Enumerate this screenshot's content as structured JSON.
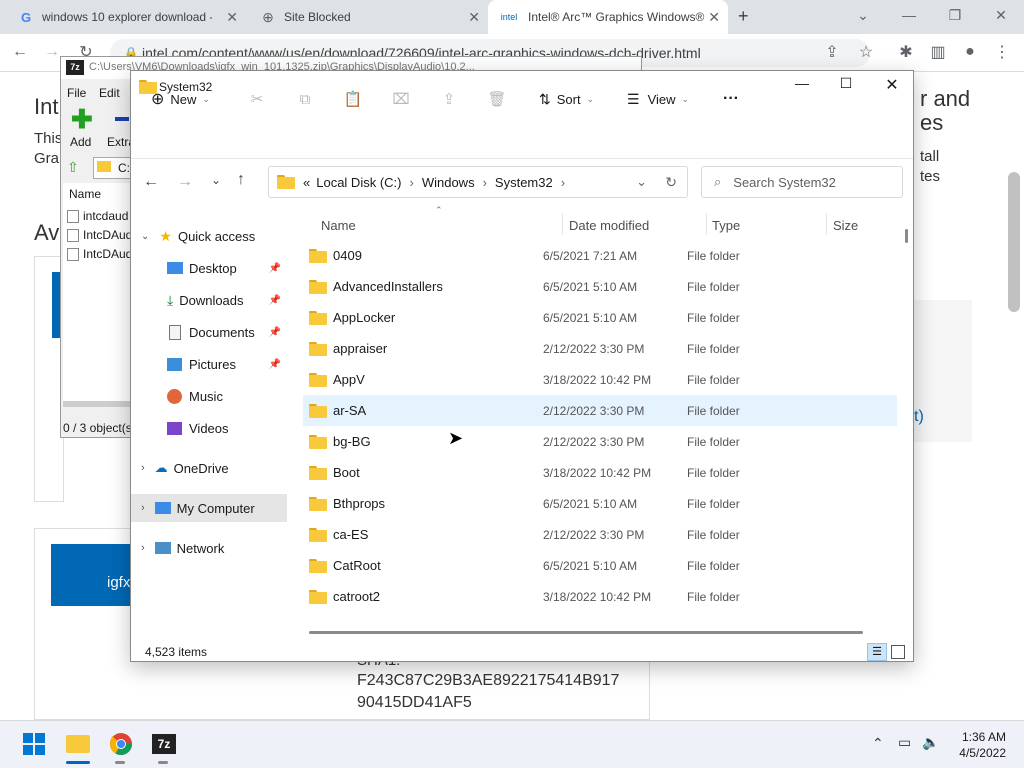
{
  "browser": {
    "tabs": [
      {
        "title": "windows 10 explorer download -"
      },
      {
        "title": "Site Blocked"
      },
      {
        "title": "Intel® Arc™ Graphics Windows®"
      }
    ],
    "new_tab": "+",
    "url": "intel.com/content/www/us/en/download/726609/intel-arc-graphics-windows-dch-driver.html"
  },
  "background_page": {
    "heading_fragment": "Intr",
    "desc_fragment1": "This",
    "desc_fragment2": "Gra",
    "right_title1": "r and",
    "right_title2": "es",
    "right_text1": "tall",
    "right_text2": "tes",
    "avail_fragment": "Av",
    "link_fragment": "t)",
    "button_fragment": "igfx",
    "hash_label": "SHA1:",
    "hash1": "F243C87C29B3AE8922175414B917",
    "hash2": "90415DD41AF5"
  },
  "sevenzip": {
    "title": "C:\\Users\\VM6\\Downloads\\igfx_win_101.1325.zip\\Graphics\\DisplayAudio\\10.2...",
    "menu_file": "File",
    "menu_edit": "Edit",
    "add_label": "Add",
    "extract_label": "Extra",
    "path_fragment": "C:",
    "col_name": "Name",
    "files": [
      "intcdaud",
      "IntcDAud",
      "IntcDAud"
    ],
    "status": "0 / 3 object(s"
  },
  "explorer": {
    "title": "System32",
    "cmd": {
      "new_label": "New",
      "sort_label": "Sort",
      "view_label": "View",
      "more_label": "···"
    },
    "breadcrumb": {
      "prefix": "«",
      "parts": [
        "Local Disk (C:)",
        "Windows",
        "System32"
      ]
    },
    "search_placeholder": "Search System32",
    "nav": {
      "quick_access": "Quick access",
      "desktop": "Desktop",
      "downloads": "Downloads",
      "documents": "Documents",
      "pictures": "Pictures",
      "music": "Music",
      "videos": "Videos",
      "onedrive": "OneDrive",
      "my_computer": "My Computer",
      "network": "Network"
    },
    "columns": {
      "name": "Name",
      "date": "Date modified",
      "type": "Type",
      "size": "Size"
    },
    "files": [
      {
        "name": "0409",
        "date": "6/5/2021 7:21 AM",
        "type": "File folder"
      },
      {
        "name": "AdvancedInstallers",
        "date": "6/5/2021 5:10 AM",
        "type": "File folder"
      },
      {
        "name": "AppLocker",
        "date": "6/5/2021 5:10 AM",
        "type": "File folder"
      },
      {
        "name": "appraiser",
        "date": "2/12/2022 3:30 PM",
        "type": "File folder"
      },
      {
        "name": "AppV",
        "date": "3/18/2022 10:42 PM",
        "type": "File folder"
      },
      {
        "name": "ar-SA",
        "date": "2/12/2022 3:30 PM",
        "type": "File folder"
      },
      {
        "name": "bg-BG",
        "date": "2/12/2022 3:30 PM",
        "type": "File folder"
      },
      {
        "name": "Boot",
        "date": "3/18/2022 10:42 PM",
        "type": "File folder"
      },
      {
        "name": "Bthprops",
        "date": "6/5/2021 5:10 AM",
        "type": "File folder"
      },
      {
        "name": "ca-ES",
        "date": "2/12/2022 3:30 PM",
        "type": "File folder"
      },
      {
        "name": "CatRoot",
        "date": "6/5/2021 5:10 AM",
        "type": "File folder"
      },
      {
        "name": "catroot2",
        "date": "3/18/2022 10:42 PM",
        "type": "File folder"
      }
    ],
    "item_count": "4,523 items"
  },
  "taskbar": {
    "time": "1:36 AM",
    "date": "4/5/2022",
    "sevenzip_label": "7z"
  },
  "colors": {
    "accent": "#0067c0",
    "folder": "#f8c93b",
    "hover_row": "#e5f3ff"
  }
}
